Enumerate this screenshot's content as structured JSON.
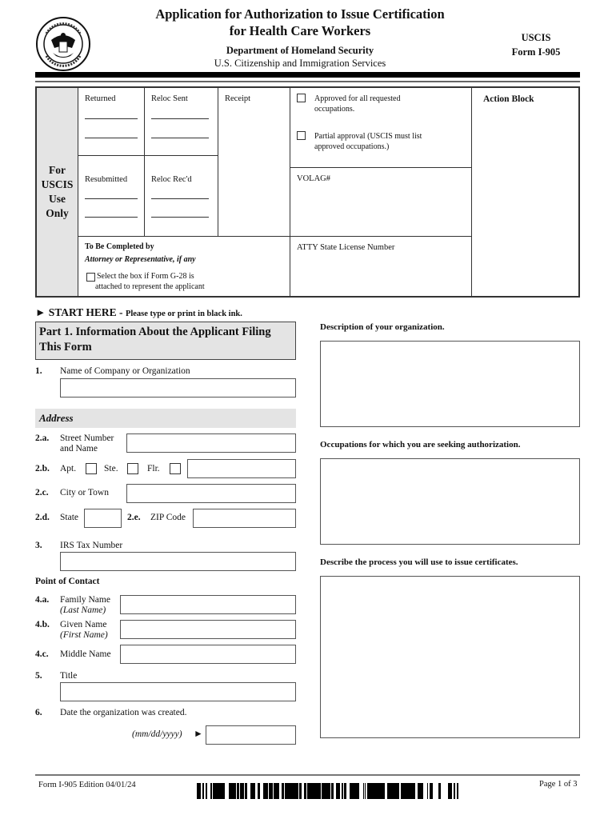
{
  "header": {
    "title_line1": "Application for Authorization to Issue Certification",
    "title_line2": "for Health Care Workers",
    "department": "Department of Homeland Security",
    "agency": "U.S. Citizenship and Immigration Services",
    "form_agency": "USCIS",
    "form_number": "Form I-905",
    "seal_icon": "dhs-seal-icon"
  },
  "uscis_box": {
    "side_label": [
      "For",
      "USCIS",
      "Use",
      "Only"
    ],
    "returned": "Returned",
    "reloc_sent": "Reloc Sent",
    "receipt": "Receipt",
    "resubmitted": "Resubmitted",
    "reloc_recd": "Reloc Rec'd",
    "approved_all_line1": "Approved for all requested",
    "approved_all_line2": "occupations.",
    "partial_line1": "Partial approval (USCIS must list",
    "partial_line2": "approved occupations.)",
    "volag": "VOLAG#",
    "action_block": "Action Block",
    "to_be_completed": "To Be Completed by",
    "attorney": "Attorney or Representative, if any",
    "g28_line1": "Select the box if Form G-28 is",
    "g28_line2": "attached to represent the applicant",
    "atty_license": "ATTY State License Number"
  },
  "start_here": {
    "arrow": "►",
    "label": "START HERE -",
    "instruction": "Please type or print in black ink."
  },
  "part1": {
    "title_line1": "Part 1.  Information About the Applicant Filing",
    "title_line2": "This Form",
    "q1": {
      "num": "1.",
      "label": "Name of Company or Organization",
      "value": ""
    },
    "address_header": "Address",
    "q2a": {
      "num": "2.a.",
      "label_line1": "Street Number",
      "label_line2": "and Name",
      "value": ""
    },
    "q2b": {
      "num": "2.b.",
      "apt": "Apt.",
      "ste": "Ste.",
      "flr": "Flr.",
      "value": ""
    },
    "q2c": {
      "num": "2.c.",
      "label": "City or Town",
      "value": ""
    },
    "q2d": {
      "num": "2.d.",
      "label": "State",
      "value": ""
    },
    "q2e": {
      "num": "2.e.",
      "label": "ZIP Code",
      "value": ""
    },
    "q3": {
      "num": "3.",
      "label": "IRS Tax Number",
      "value": ""
    },
    "poc_header": "Point of Contact",
    "q4a": {
      "num": "4.a.",
      "label": "Family Name",
      "sub": "(Last Name)",
      "value": ""
    },
    "q4b": {
      "num": "4.b.",
      "label": "Given Name",
      "sub": "(First Name)",
      "value": ""
    },
    "q4c": {
      "num": "4.c.",
      "label": "Middle Name",
      "value": ""
    },
    "q5": {
      "num": "5.",
      "label": "Title",
      "value": ""
    },
    "q6": {
      "num": "6.",
      "label": "Date the organization was created.",
      "format": "(mm/dd/yyyy)",
      "arrow": "►",
      "value": ""
    }
  },
  "right_column": {
    "description_label": "Description of your organization.",
    "occupations_label": "Occupations for which you are seeking authorization.",
    "process_label": "Describe the process you will use to issue certificates."
  },
  "footer": {
    "form_edition": "Form I-905   Edition   04/01/24",
    "page": "Page 1 of 3"
  }
}
